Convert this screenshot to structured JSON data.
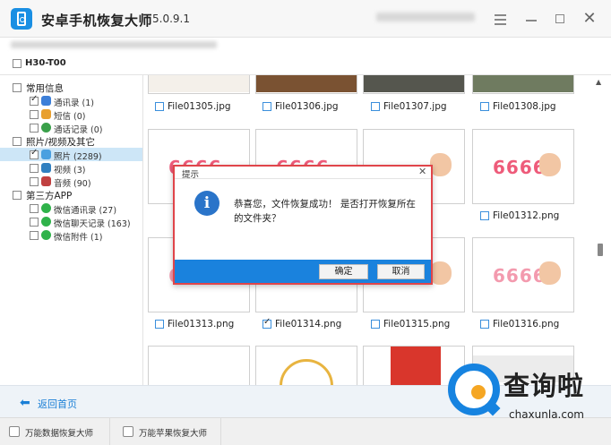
{
  "app": {
    "title": "安卓手机恢复大师",
    "version": "5.0.9.1"
  },
  "device": {
    "name": "H30-T00"
  },
  "sidebar": {
    "groups": [
      {
        "label": "常用信息",
        "items": [
          {
            "label": "通讯录 (1)",
            "checked": true,
            "icon": "contacts-icon",
            "color": "#3d7fd8"
          },
          {
            "label": "短信 (0)",
            "checked": false,
            "icon": "sms-icon",
            "color": "#e8a030"
          },
          {
            "label": "通话记录 (0)",
            "checked": false,
            "icon": "call-log-icon",
            "color": "#3aa04a"
          }
        ]
      },
      {
        "label": "照片/视频及其它",
        "items": [
          {
            "label": "照片 (2289)",
            "checked": true,
            "icon": "photo-icon",
            "color": "#4aa0e0"
          },
          {
            "label": "视频 (3)",
            "checked": false,
            "icon": "video-icon",
            "color": "#2f7fc0"
          },
          {
            "label": "音频 (90)",
            "checked": false,
            "icon": "audio-icon",
            "color": "#c04040"
          }
        ]
      },
      {
        "label": "第三方APP",
        "items": [
          {
            "label": "微信通讯录 (27)",
            "checked": false,
            "icon": "wechat-icon",
            "color": "#2fb24a"
          },
          {
            "label": "微信聊天记录 (163)",
            "checked": false,
            "icon": "wechat-icon",
            "color": "#2fb24a"
          },
          {
            "label": "微信附件 (1)",
            "checked": false,
            "icon": "wechat-icon",
            "color": "#2fb24a"
          }
        ]
      }
    ]
  },
  "files": {
    "row1": [
      "File01305.jpg",
      "File01306.jpg",
      "File01307.jpg",
      "File01308.jpg"
    ],
    "row2_visible": [
      "File01312.png"
    ],
    "row3": [
      "File01313.png",
      "File01314.png",
      "File01315.png",
      "File01316.png"
    ],
    "row3_checked": [
      false,
      true,
      false,
      false
    ],
    "thumb_text": "6666"
  },
  "dialog": {
    "title": "提示",
    "close_glyph": "✕",
    "icon_glyph": "i",
    "message": "恭喜您，文件恢复成功！ 是否打开恢复所在的文件夹？",
    "ok_label": "确定",
    "cancel_label": "取消"
  },
  "footer": {
    "back_arrow": "⬅",
    "back_label": "返回首页"
  },
  "statusbar": {
    "tabs": [
      "万能数据恢复大师",
      "万能苹果恢复大师"
    ]
  },
  "watermark": {
    "text": "查询啦",
    "domain": "chaxunla.com"
  },
  "window_controls": {
    "close_glyph": "✕"
  },
  "colors": {
    "accent": "#1a82dd",
    "dialog_border": "#e0454a",
    "selection": "#cde6f7",
    "link": "#1a7fd6"
  }
}
